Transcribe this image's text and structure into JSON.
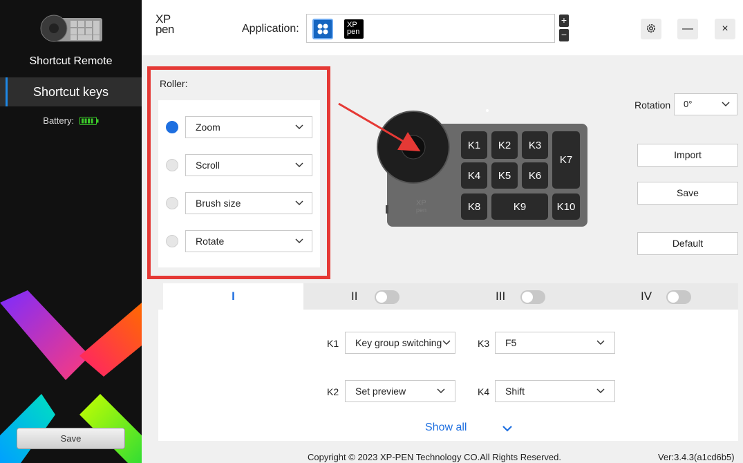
{
  "sidebar": {
    "title": "Shortcut Remote",
    "nav_item": "Shortcut keys",
    "battery_label": "Battery:",
    "save_label": "Save"
  },
  "header": {
    "logo_line1": "XP",
    "logo_line2": "pen",
    "application_label": "Application:",
    "app_icon_text_1": "XP",
    "app_icon_text_2": "pen",
    "add_symbol": "+",
    "remove_symbol": "−",
    "minimize_symbol": "—",
    "close_symbol": "×"
  },
  "roller": {
    "title": "Roller:",
    "options": [
      {
        "label": "Zoom",
        "selected": true
      },
      {
        "label": "Scroll",
        "selected": false
      },
      {
        "label": "Brush size",
        "selected": false
      },
      {
        "label": "Rotate",
        "selected": false
      }
    ]
  },
  "device": {
    "keys": [
      "K1",
      "K2",
      "K3",
      "K4",
      "K5",
      "K6",
      "K7",
      "K8",
      "K9",
      "K10"
    ],
    "brand_line1": "XP",
    "brand_line2": "pen"
  },
  "controls": {
    "rotation_label": "Rotation",
    "rotation_value": "0°",
    "import_label": "Import",
    "save_label": "Save",
    "default_label": "Default"
  },
  "key_groups": {
    "tabs": [
      {
        "label": "I",
        "active": true
      },
      {
        "label": "II",
        "enabled": false
      },
      {
        "label": "III",
        "enabled": false
      },
      {
        "label": "IV",
        "enabled": false
      }
    ],
    "assignments": [
      {
        "key": "K1",
        "action": "Key group switching"
      },
      {
        "key": "K3",
        "action": "F5"
      },
      {
        "key": "K2",
        "action": "Set preview"
      },
      {
        "key": "K4",
        "action": "Shift"
      }
    ],
    "show_all_label": "Show all"
  },
  "footer": {
    "copyright": "Copyright © 2023  XP-PEN Technology CO.All Rights Reserved.",
    "version": "Ver:3.4.3(a1cd6b5)"
  },
  "colors": {
    "accent_blue": "#1e6fe0",
    "highlight_red": "#e53935",
    "battery_green": "#3ccb2a",
    "sidebar_bg": "#111111"
  }
}
